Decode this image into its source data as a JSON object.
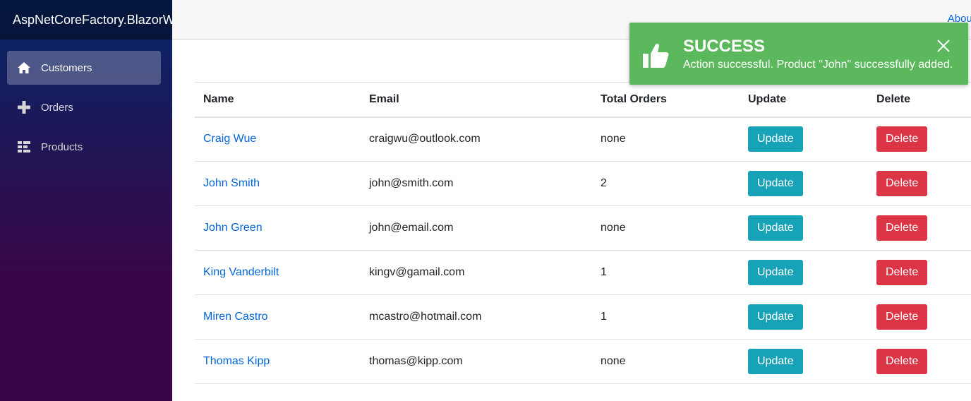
{
  "app": {
    "brand": "AspNetCoreFactory.BlazorWasm"
  },
  "topbar": {
    "about_label": "About"
  },
  "sidebar": {
    "items": [
      {
        "label": "Customers",
        "icon": "home-icon",
        "active": true
      },
      {
        "label": "Orders",
        "icon": "plus-icon",
        "active": false
      },
      {
        "label": "Products",
        "icon": "list-icon",
        "active": false
      }
    ]
  },
  "table": {
    "headers": [
      "Name",
      "Email",
      "Total Orders",
      "Update",
      "Delete"
    ],
    "rows": [
      {
        "name": "Craig Wue",
        "email": "craigwu@outlook.com",
        "total_orders": "none"
      },
      {
        "name": "John Smith",
        "email": "john@smith.com",
        "total_orders": "2"
      },
      {
        "name": "John Green",
        "email": "john@email.com",
        "total_orders": "none"
      },
      {
        "name": "King Vanderbilt",
        "email": "kingv@gamail.com",
        "total_orders": "1"
      },
      {
        "name": "Miren Castro",
        "email": "mcastro@hotmail.com",
        "total_orders": "1"
      },
      {
        "name": "Thomas Kipp",
        "email": "thomas@kipp.com",
        "total_orders": "none"
      }
    ],
    "update_label": "Update",
    "delete_label": "Delete"
  },
  "toast": {
    "title": "SUCCESS",
    "message": "Action successful. Product \"John\" successfully added.",
    "icon": "thumbs-up-icon",
    "close_icon": "close-icon",
    "color": "#5cb85c"
  },
  "colors": {
    "update": "#17a2b8",
    "delete": "#dc3545",
    "link": "#0366d6"
  }
}
